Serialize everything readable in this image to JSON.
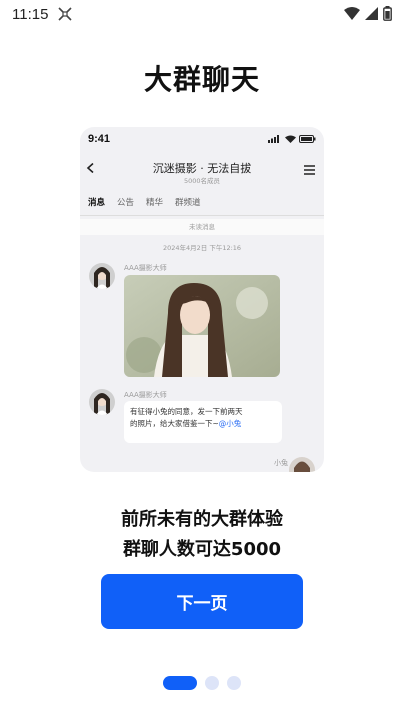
{
  "status_bar": {
    "time": "11:15",
    "icons": [
      "screenshot-icon",
      "wifi-icon",
      "signal-icon",
      "battery-icon"
    ]
  },
  "page": {
    "title": "大群聊天",
    "description_line1": "前所未有的大群体验",
    "description_line2": "群聊人数可达5000",
    "next_button": "下一页",
    "pager": {
      "total": 3,
      "active_index": 0
    }
  },
  "phone_preview": {
    "status_time": "9:41",
    "chat_title": "沉迷摄影 · 无法自拔",
    "chat_subtitle": "5000名成员",
    "tabs": [
      "消息",
      "公告",
      "精华",
      "群频道"
    ],
    "active_tab": "消息",
    "unread_label": "未读消息",
    "date_label": "2024年4月2日 下午12:16",
    "messages": [
      {
        "sender": "AAA摄影大师",
        "type": "image"
      },
      {
        "sender": "AAA摄影大师",
        "type": "text",
        "text_line1": "有征得小兔的同意，发一下前两天",
        "text_line2": "的照片，给大家借鉴一下~",
        "mention": "@小兔"
      }
    ],
    "self_name": "小兔"
  },
  "colors": {
    "accent": "#1060f8",
    "dot_inactive": "#dde4f8",
    "phone_bg": "#f1f1f4",
    "mention": "#2a6df4"
  }
}
